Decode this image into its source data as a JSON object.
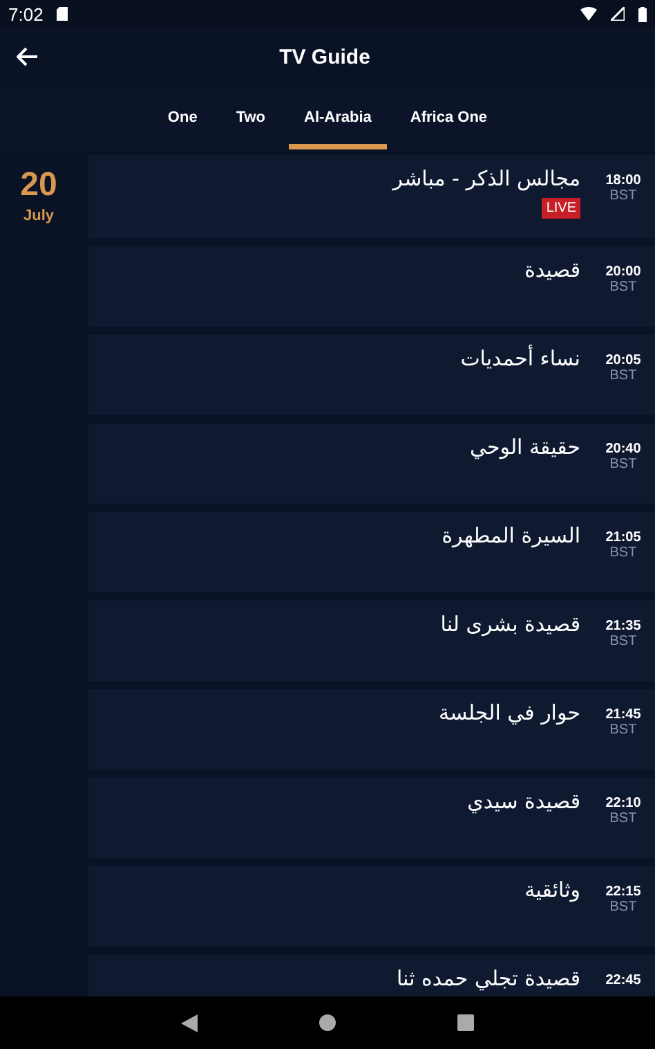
{
  "status_bar": {
    "time": "7:02"
  },
  "app_bar": {
    "title": "TV Guide"
  },
  "tabs": [
    {
      "label": "One",
      "selected": false
    },
    {
      "label": "Two",
      "selected": false
    },
    {
      "label": "Al-Arabia",
      "selected": true
    },
    {
      "label": "Africa One",
      "selected": false
    }
  ],
  "date": {
    "day": "20",
    "month": "July"
  },
  "programmes": [
    {
      "title": "مجالس الذكر - مباشر",
      "time": "18:00",
      "zone": "BST",
      "live": true,
      "badge": "LIVE"
    },
    {
      "title": "قصيدة",
      "time": "20:00",
      "zone": "BST",
      "live": false
    },
    {
      "title": "نساء أحمديات",
      "time": "20:05",
      "zone": "BST",
      "live": false
    },
    {
      "title": "حقيقة الوحي",
      "time": "20:40",
      "zone": "BST",
      "live": false
    },
    {
      "title": "السيرة المطهرة",
      "time": "21:05",
      "zone": "BST",
      "live": false
    },
    {
      "title": "قصيدة بشرى لنا",
      "time": "21:35",
      "zone": "BST",
      "live": false
    },
    {
      "title": "حوار في الجلسة",
      "time": "21:45",
      "zone": "BST",
      "live": false
    },
    {
      "title": "قصيدة سيدي",
      "time": "22:10",
      "zone": "BST",
      "live": false
    },
    {
      "title": "وثائقية",
      "time": "22:15",
      "zone": "BST",
      "live": false
    },
    {
      "title": "قصيدة تجلي حمده ثنا",
      "time": "22:45",
      "live": false
    }
  ]
}
